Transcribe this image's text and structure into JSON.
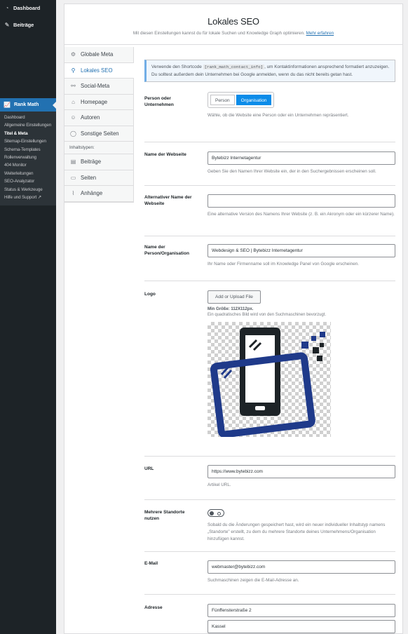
{
  "admin_menu": {
    "top_items": [
      {
        "label": "Dashboard",
        "icon": "gauge-icon"
      },
      {
        "label": "Beiträge",
        "icon": "pin-icon"
      }
    ],
    "rank_math": {
      "label": "Rank Math",
      "submenu": [
        "Dashboard",
        "Allgemeine Einstellungen",
        "Titel & Meta",
        "Sitemap-Einstellungen",
        "Schema-Templates",
        "Rollenverwaltung",
        "404 Monitor",
        "Weiterleitungen",
        "SEO-Analyzator",
        "Status & Werkzeuge",
        "Hilfe und Support ↗"
      ],
      "current": "Titel & Meta"
    }
  },
  "page": {
    "title": "Lokales SEO",
    "subtitle": "Mit diesen Einstellungen kannst du für lokale Suchen und Knowledge Graph optimieren.",
    "learn_more": "Mehr erfahren"
  },
  "tabs": [
    {
      "label": "Globale Meta",
      "icon": "gear-icon"
    },
    {
      "label": "Lokales SEO",
      "icon": "map-pin-icon",
      "active": true
    },
    {
      "label": "Social-Meta",
      "icon": "share-icon"
    },
    {
      "label": "Homepage",
      "icon": "home-icon"
    },
    {
      "label": "Autoren",
      "icon": "users-icon"
    },
    {
      "label": "Sonstige Seiten",
      "icon": "circle-icon"
    },
    {
      "label": "Inhaltstypen:",
      "section": true
    },
    {
      "label": "Beiträge",
      "icon": "post-icon"
    },
    {
      "label": "Seiten",
      "icon": "page-icon"
    },
    {
      "label": "Anhänge",
      "icon": "paperclip-icon"
    }
  ],
  "notice": {
    "before": "Verwende den Shortcode",
    "code": "[rank_math_contact_info]",
    "after": ", um Kontaktinformationen ansprechend formatiert anzuzeigen. Du solltest außerdem dein Unternehmen bei Google anmelden, wenn du das nicht bereits getan hast."
  },
  "fields": {
    "entity": {
      "label": "Person oder Unternehmen",
      "options": [
        "Person",
        "Organisation"
      ],
      "selected": "Organisation",
      "desc": "Wähle, ob die Website eine Person oder ein Unternehmen repräsentiert."
    },
    "site_name": {
      "label": "Name der Webseite",
      "value": "Bytebizz Internetagentur",
      "desc": "Geben Sie den Namen Ihrer Website ein, der in den Suchergebnissen erscheinen soll."
    },
    "alt_name": {
      "label": "Alternativer Name der Webseite",
      "value": "",
      "desc": "Eine alternative Version des Namens Ihrer Website (z. B. ein Akronym oder ein kürzerer Name)."
    },
    "org_name": {
      "label": "Name der Person/Organisation",
      "value": "Webdesign & SEO | Bytebizz Internetagentur",
      "desc": "Ihr Name oder Firmenname soll im Knowledge Panel von Google erscheinen."
    },
    "logo": {
      "label": "Logo",
      "button": "Add or Upload File",
      "min_size": "Min Größe: 112X112px.",
      "desc": "Ein quadratisches Bild wird von den Suchmaschinen bevorzugt."
    },
    "url": {
      "label": "URL",
      "value": "https://www.bytebizz.com",
      "desc": "Artikel URL."
    },
    "locations": {
      "label": "Mehrere Standorte nutzen",
      "enabled": false,
      "desc": "Sobald du die Änderungen gespeichert hast, wird ein neuer individueller Inhaltstyp namens „Standorte\" erstellt, zu dem du mehrere Standorte deines Unternehmens/Organisation hinzufügen kannst."
    },
    "email": {
      "label": "E-Mail",
      "value": "webmaster@bytebizz.com",
      "desc": "Suchmaschinen zeigen die E-Mail-Adresse an."
    },
    "address": {
      "label": "Adresse",
      "street": "Fünffensterstraße 2",
      "city": "Kassel"
    }
  },
  "colors": {
    "primary": "#0c8ce9",
    "accent_blue": "#2271b1",
    "logo_dark": "#1d2327",
    "logo_navy": "#1f3a8a"
  }
}
